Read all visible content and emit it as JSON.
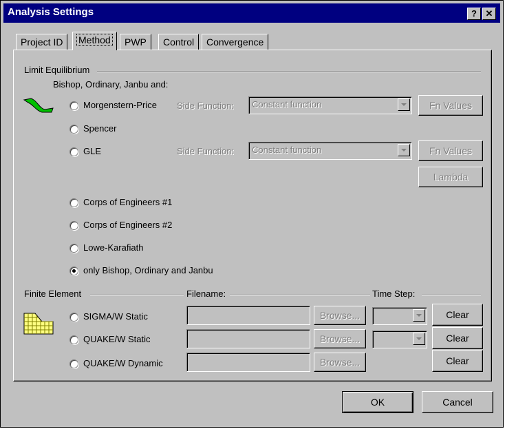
{
  "window": {
    "title": "Analysis Settings",
    "help_button": "?",
    "close_button": "✕"
  },
  "tabs": [
    {
      "label": "Project ID"
    },
    {
      "label": "Method",
      "active": true
    },
    {
      "label": "PWP"
    },
    {
      "label": "Control"
    },
    {
      "label": "Convergence"
    }
  ],
  "limit_equilibrium": {
    "group_label": "Limit Equilibrium",
    "subtitle": "Bishop, Ordinary, Janbu and:",
    "side_function_label": "Side Function:",
    "morgenstern_price": {
      "label": "Morgenstern-Price",
      "side_function_value": "Constant function",
      "fn_values_button": "Fn Values"
    },
    "spencer": {
      "label": "Spencer"
    },
    "gle": {
      "label": "GLE",
      "side_function_value": "Constant function",
      "fn_values_button": "Fn Values",
      "lambda_button": "Lambda"
    },
    "corps1": {
      "label": "Corps of Engineers #1"
    },
    "corps2": {
      "label": "Corps of Engineers #2"
    },
    "lowe_karafiath": {
      "label": "Lowe-Karafiath"
    },
    "only_bishop": {
      "label": "only Bishop, Ordinary and Janbu",
      "selected": true
    }
  },
  "finite_element": {
    "group_label": "Finite Element",
    "filename_label": "Filename:",
    "time_step_label": "Time Step:",
    "browse_label": "Browse...",
    "clear_label": "Clear",
    "sigma_static": {
      "label": "SIGMA/W Static",
      "filename": ""
    },
    "quake_static": {
      "label": "QUAKE/W Static",
      "filename": ""
    },
    "quake_dynamic": {
      "label": "QUAKE/W Dynamic",
      "filename": ""
    }
  },
  "footer": {
    "ok_label": "OK",
    "cancel_label": "Cancel"
  },
  "colors": {
    "titlebar": "#000080",
    "face": "#c0c0c0",
    "slope_icon": "#00c000",
    "grid_icon": "#ffff80"
  }
}
